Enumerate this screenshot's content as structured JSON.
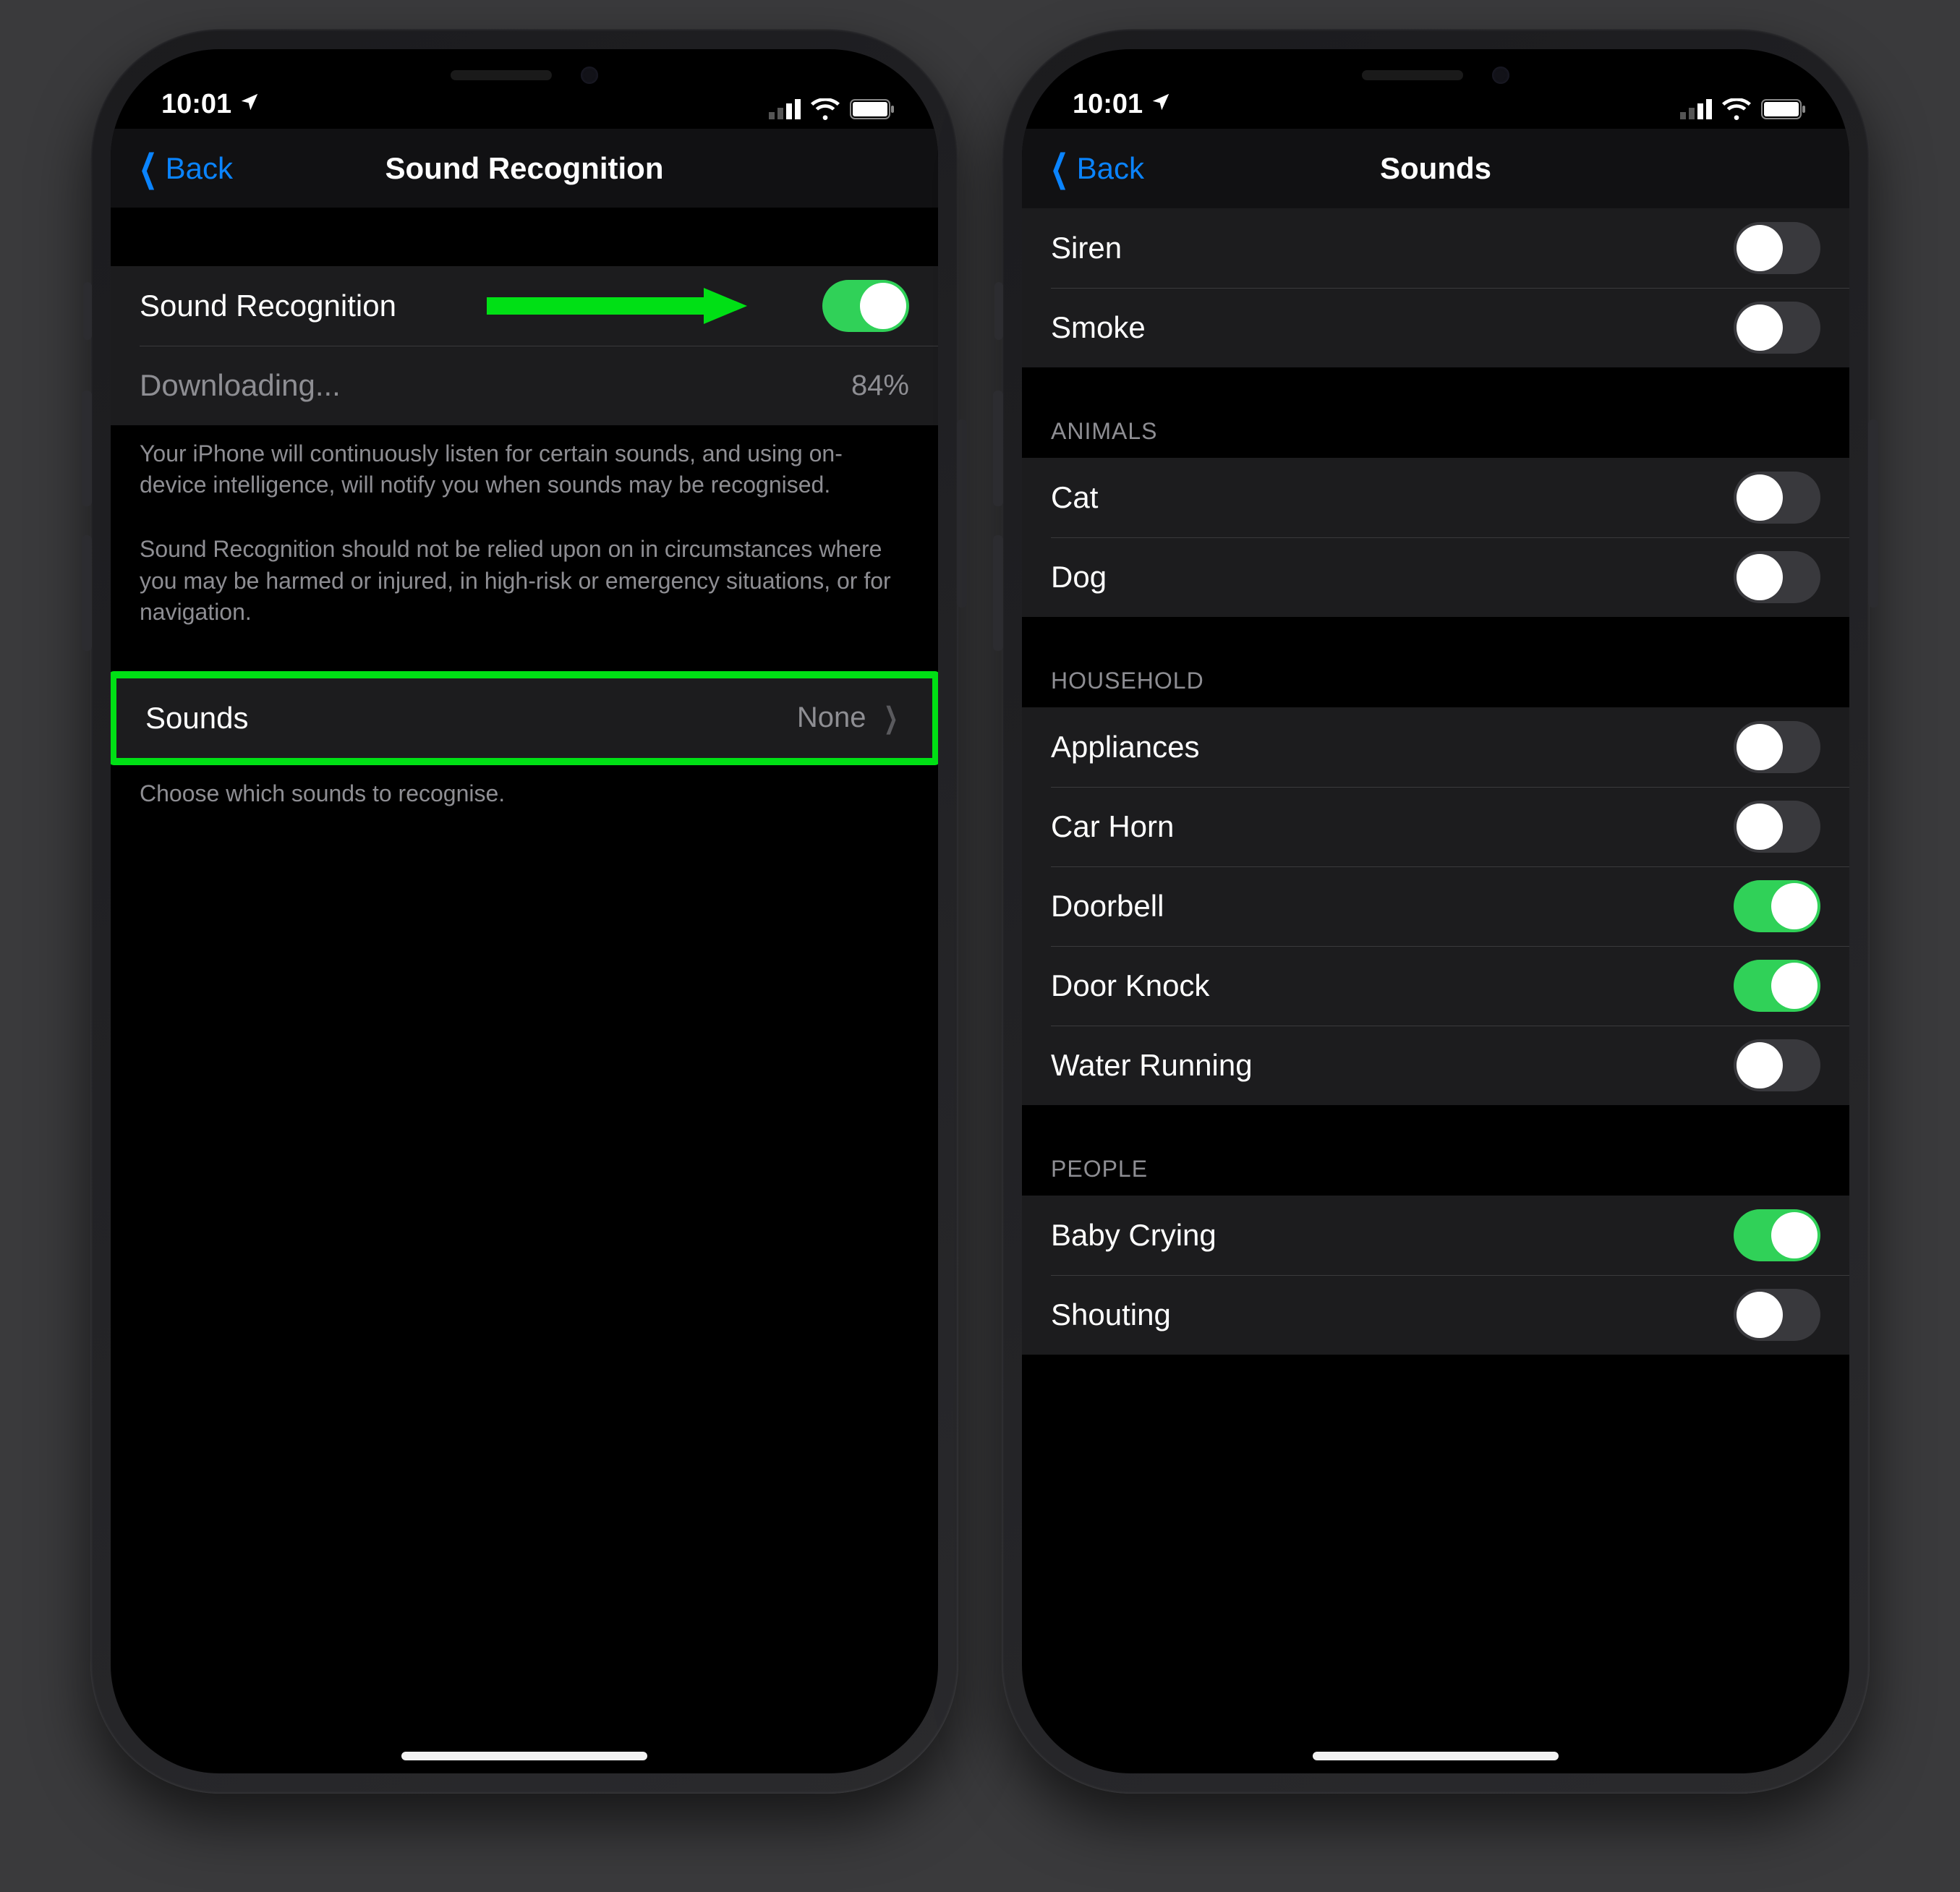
{
  "status": {
    "time": "10:01"
  },
  "left": {
    "nav": {
      "back": "Back",
      "title": "Sound Recognition"
    },
    "main_toggle": {
      "label": "Sound Recognition",
      "on": true
    },
    "download": {
      "label": "Downloading...",
      "percent": "84%"
    },
    "footer1": "Your iPhone will continuously listen for certain sounds, and using on-device intelligence, will notify you when sounds may be recognised.",
    "footer2": "Sound Recognition should not be relied upon on in circumstances where you may be harmed or injured, in high-risk or emergency situations, or for navigation.",
    "sounds_row": {
      "label": "Sounds",
      "value": "None"
    },
    "sounds_footer": "Choose which sounds to recognise."
  },
  "right": {
    "nav": {
      "back": "Back",
      "title": "Sounds"
    },
    "groups": {
      "alarms": {
        "items": [
          {
            "label": "Siren",
            "on": false
          },
          {
            "label": "Smoke",
            "on": false
          }
        ]
      },
      "animals": {
        "header": "ANIMALS",
        "items": [
          {
            "label": "Cat",
            "on": false
          },
          {
            "label": "Dog",
            "on": false
          }
        ]
      },
      "household": {
        "header": "HOUSEHOLD",
        "items": [
          {
            "label": "Appliances",
            "on": false
          },
          {
            "label": "Car Horn",
            "on": false
          },
          {
            "label": "Doorbell",
            "on": true
          },
          {
            "label": "Door Knock",
            "on": true
          },
          {
            "label": "Water Running",
            "on": false
          }
        ]
      },
      "people": {
        "header": "PEOPLE",
        "items": [
          {
            "label": "Baby Crying",
            "on": true
          },
          {
            "label": "Shouting",
            "on": false
          }
        ]
      }
    }
  }
}
